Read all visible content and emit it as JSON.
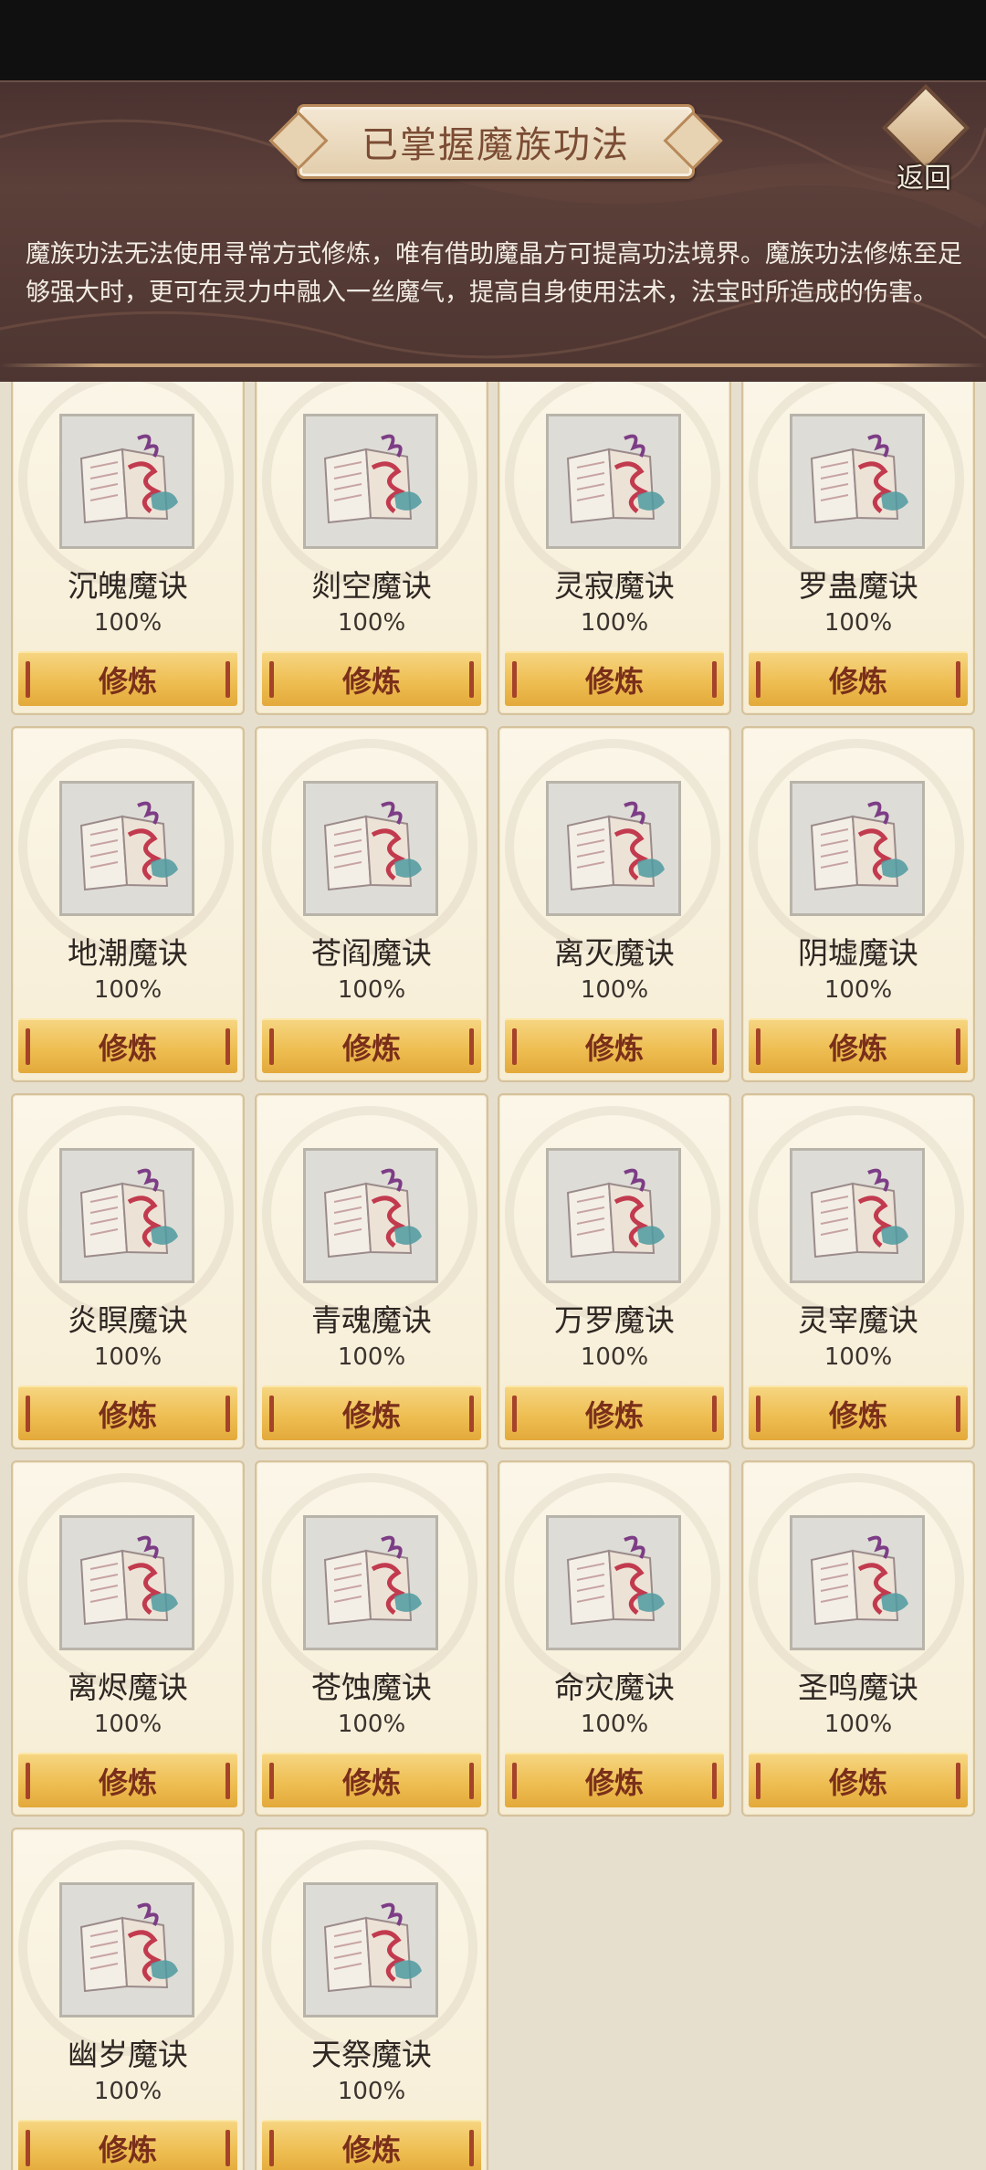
{
  "header": {
    "title": "已掌握魔族功法",
    "back_label": "返回",
    "description": "魔族功法无法使用寻常方式修炼，唯有借助魔晶方可提高功法境界。魔族功法修炼至足够强大时，更可在灵力中融入一丝魔气，提高自身使用法术，法宝时所造成的伤害。"
  },
  "train_label": "修炼",
  "skills": [
    {
      "name": "沉魄魔诀",
      "progress": "100%"
    },
    {
      "name": "剡空魔诀",
      "progress": "100%"
    },
    {
      "name": "灵寂魔诀",
      "progress": "100%"
    },
    {
      "name": "罗蛊魔诀",
      "progress": "100%"
    },
    {
      "name": "地潮魔诀",
      "progress": "100%"
    },
    {
      "name": "苍阎魔诀",
      "progress": "100%"
    },
    {
      "name": "离灭魔诀",
      "progress": "100%"
    },
    {
      "name": "阴墟魔诀",
      "progress": "100%"
    },
    {
      "name": "炎瞑魔诀",
      "progress": "100%"
    },
    {
      "name": "青魂魔诀",
      "progress": "100%"
    },
    {
      "name": "万罗魔诀",
      "progress": "100%"
    },
    {
      "name": "灵宰魔诀",
      "progress": "100%"
    },
    {
      "name": "离烬魔诀",
      "progress": "100%"
    },
    {
      "name": "苍蚀魔诀",
      "progress": "100%"
    },
    {
      "name": "命灾魔诀",
      "progress": "100%"
    },
    {
      "name": "圣鸣魔诀",
      "progress": "100%"
    },
    {
      "name": "幽岁魔诀",
      "progress": "100%"
    },
    {
      "name": "天祭魔诀",
      "progress": "100%"
    }
  ],
  "icons": {
    "back": "back-arrow-icon",
    "skill": "demon-scroll-book-icon"
  }
}
